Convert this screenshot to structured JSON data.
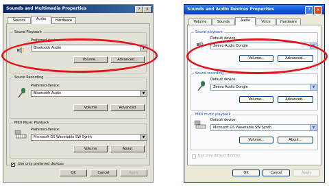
{
  "left": {
    "title": "Sounds and Multimedia Properties",
    "title_buttons": [
      "?",
      "X"
    ],
    "tabs": [
      "Sounds",
      "Audio",
      "Hardware"
    ],
    "groups": {
      "playback": {
        "title": "Sound Playback",
        "pref_label": "Preferred device:",
        "device": "Bluetooth Audio",
        "buttons": [
          "Volume...",
          "Advanced..."
        ]
      },
      "recording": {
        "title": "Sound Recording",
        "pref_label": "Preferred device:",
        "device": "Bluetooth Audio",
        "buttons": [
          "Volume",
          "Advanced"
        ]
      },
      "midi": {
        "title": "MIDI Music Playback",
        "pref_label": "Preferred device:",
        "device": "Microsoft GS Wavetable SW Synth",
        "buttons": [
          "Volume",
          "About"
        ]
      }
    },
    "checkbox_label": "Use only preferred devices",
    "checkbox_checked": "✔",
    "footer": [
      "OK",
      "Cancel",
      "Apply"
    ]
  },
  "right": {
    "title": "Sounds and Audio Devices Properties",
    "title_buttons": [
      "?",
      "X"
    ],
    "tabs": [
      "Volume",
      "Sounds",
      "Audio",
      "Voice",
      "Hardware"
    ],
    "groups": {
      "playback": {
        "title": "Sound playback",
        "default_label": "Default device:",
        "device": "Zeevo Audio Dongle",
        "buttons": [
          "Volume...",
          "Advanced..."
        ]
      },
      "recording": {
        "title": "Sound recording",
        "default_label": "Default device:",
        "device": "Zeevo Audio Dongle",
        "buttons": [
          "Volume...",
          "Advanced..."
        ]
      },
      "midi": {
        "title": "MIDI music playback",
        "default_label": "Default device:",
        "device": "Microsoft GS Wavetable SW Synth",
        "buttons": [
          "Volume...",
          "About..."
        ]
      }
    },
    "checkbox_label": "Use only default devices",
    "footer": [
      "OK",
      "Cancel",
      "Apply"
    ]
  },
  "colors": {
    "highlight": "#e3141b",
    "xp_title": "#0a52d8",
    "classic_title": "#0a246a"
  },
  "icons": [
    "speaker-icon",
    "microphone-icon",
    "midi-keyboard-icon"
  ]
}
